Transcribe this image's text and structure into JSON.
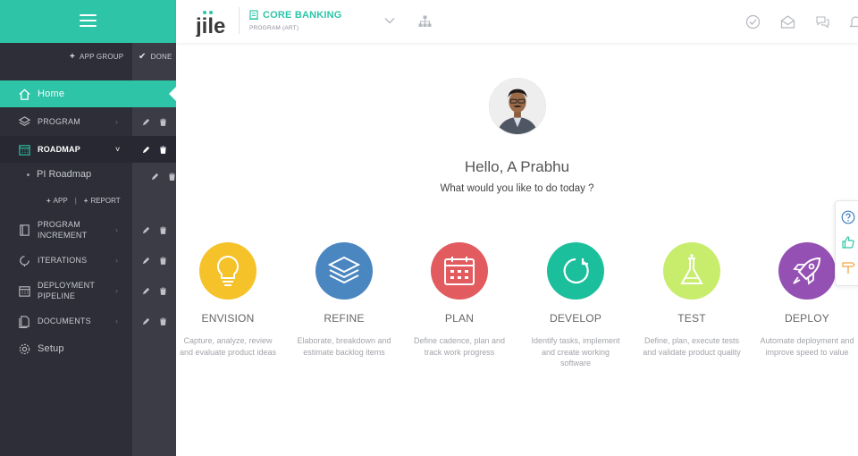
{
  "sidebar": {
    "actions": {
      "app_group": "APP GROUP",
      "done": "DONE"
    },
    "home_label": "Home",
    "items": {
      "program": "PROGRAM",
      "roadmap": "ROADMAP",
      "program_increment": "PROGRAM INCREMENT",
      "iterations": "ITERATIONS",
      "deployment_pipeline": "DEPLOYMENT PIPELINE",
      "documents": "DOCUMENTS",
      "setup": "Setup"
    },
    "sub_item": "PI Roadmap",
    "sub_actions": {
      "app": "APP",
      "report": "REPORT"
    }
  },
  "header": {
    "brand": "jile",
    "project_title": "CORE BANKING",
    "project_subtitle": "PROGRAM (ART)"
  },
  "main": {
    "greeting": "Hello, A Prabhu",
    "question": "What would you like to do today ?",
    "cards": [
      {
        "title": "ENVISION",
        "desc": "Capture, analyze, review and evaluate product ideas",
        "color": "#f6c22a",
        "icon": "lightbulb-icon"
      },
      {
        "title": "REFINE",
        "desc": "Elaborate, breakdown and estimate backlog items",
        "color": "#4a86c0",
        "icon": "layers-icon"
      },
      {
        "title": "PLAN",
        "desc": "Define cadence, plan and track work progress",
        "color": "#e25b5e",
        "icon": "calendar-icon"
      },
      {
        "title": "DEVELOP",
        "desc": "Identify tasks, implement and create working software",
        "color": "#1cbf9b",
        "icon": "cycle-icon"
      },
      {
        "title": "TEST",
        "desc": "Define, plan, execute tests and validate product quality",
        "color": "#c8ec6c",
        "icon": "flask-icon"
      },
      {
        "title": "DEPLOY",
        "desc": "Automate deployment and improve speed to value",
        "color": "#9451b3",
        "icon": "rocket-icon"
      }
    ]
  },
  "colors": {
    "accent": "#2ec4a8",
    "sidebar": "#2d2e37"
  }
}
